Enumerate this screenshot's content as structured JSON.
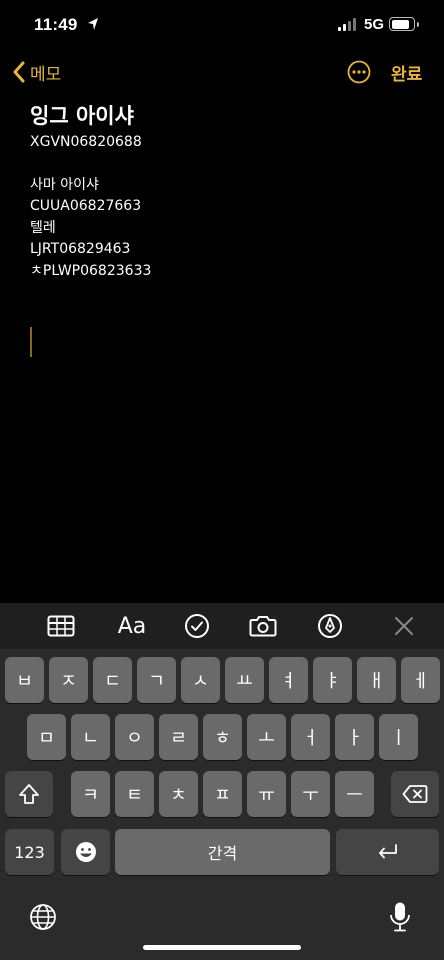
{
  "status": {
    "time": "11:49",
    "network": "5G"
  },
  "nav": {
    "back_label": "메모",
    "done_label": "완료"
  },
  "note": {
    "title": "잉그 아이샤",
    "lines_a": [
      "XGVN06820688"
    ],
    "lines_b": [
      "사마 아이샤",
      "CUUA06827663",
      "텔레",
      "LJRT06829463",
      "ㅊPLWP06823633"
    ]
  },
  "toolbar": {
    "format_label": "Aa"
  },
  "keyboard": {
    "row1": [
      "ㅂ",
      "ㅈ",
      "ㄷ",
      "ㄱ",
      "ㅅ",
      "ㅛ",
      "ㅕ",
      "ㅑ",
      "ㅐ",
      "ㅔ"
    ],
    "row2": [
      "ㅁ",
      "ㄴ",
      "ㅇ",
      "ㄹ",
      "ㅎ",
      "ㅗ",
      "ㅓ",
      "ㅏ",
      "ㅣ"
    ],
    "row3": [
      "ㅋ",
      "ㅌ",
      "ㅊ",
      "ㅍ",
      "ㅠ",
      "ㅜ",
      "ㅡ"
    ],
    "numbers_label": "123",
    "space_label": "간격"
  },
  "colors": {
    "accent": "#e8b536",
    "background": "#000000",
    "key": "#6a6a6a",
    "key_dark": "#454545"
  },
  "icons": [
    "location-arrow-icon",
    "signal-icon",
    "battery-icon",
    "chevron-left-icon",
    "more-icon",
    "table-icon",
    "checklist-icon",
    "camera-icon",
    "markup-icon",
    "close-icon",
    "shift-icon",
    "delete-icon",
    "emoji-icon",
    "return-icon",
    "globe-icon",
    "microphone-icon"
  ]
}
